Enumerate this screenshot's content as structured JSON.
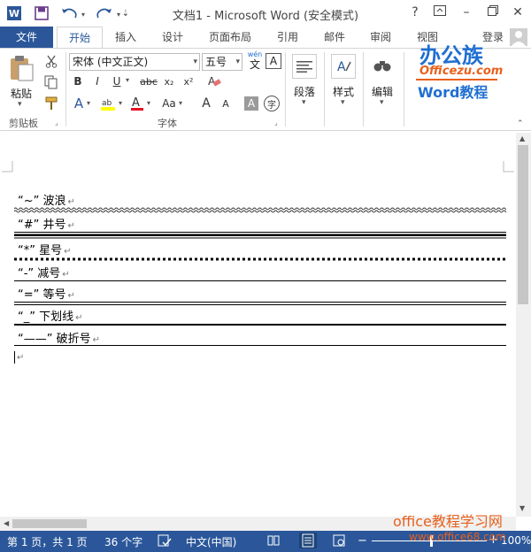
{
  "window": {
    "title": "文档1 - Microsoft Word (安全模式)",
    "help": "?",
    "minimize": "–",
    "close": "✕",
    "signin": "登录"
  },
  "tabs": [
    "文件",
    "开始",
    "插入",
    "设计",
    "页面布局",
    "引用",
    "邮件",
    "审阅",
    "视图"
  ],
  "ribbon": {
    "paste_label": "粘贴",
    "clipboard_group": "剪贴板",
    "font_name": "宋体 (中文正文)",
    "font_size": "五号",
    "wen": "wén",
    "wen_char": "文",
    "font_group": "字体",
    "paragraph_label": "段落",
    "styles_label": "样式",
    "edit_label": "编辑",
    "bold": "B",
    "italic": "I",
    "underline": "U",
    "strike": "abc",
    "sub": "x₂",
    "sup": "x²",
    "aa": "Aa",
    "grow": "A",
    "shrink": "A",
    "char_shade": "A",
    "enclosed": "字",
    "font_color": "A"
  },
  "document": {
    "lines": [
      "“~” 波浪",
      "“#” 井号",
      "“*” 星号",
      "“-” 减号",
      "“=” 等号",
      "“_” 下划线",
      "“——” 破折号"
    ],
    "para_mark": "↵"
  },
  "status": {
    "page": "第 1 页，共 1 页",
    "words": "36 个字",
    "lang": "中文(中国)",
    "zoom": "100%"
  },
  "brand": {
    "logo": "办公族",
    "site": "Officezu.com",
    "course": "Word教程",
    "footer_site": "office教程学习网",
    "footer_url": "www.office68.com"
  },
  "colors": {
    "accent": "#2b579a",
    "brand_orange": "#e8601c",
    "brand_blue": "#1f6fd1"
  }
}
